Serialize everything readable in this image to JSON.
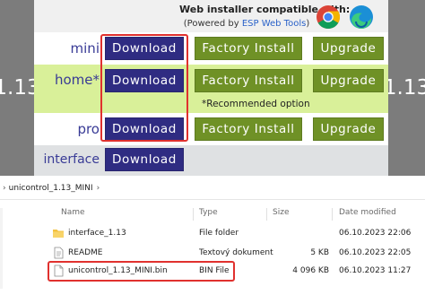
{
  "installer": {
    "version_left": "1.13",
    "version_right": "1.13",
    "header_title": "Web installer compatible with:",
    "header_sub_prefix": "(Powered by ",
    "header_sub_link": "ESP Web Tools",
    "header_sub_suffix": ")",
    "browsers": [
      "chrome-icon",
      "edge-icon"
    ],
    "rows": [
      {
        "label": "mini",
        "download": "Download",
        "factory": "Factory Install",
        "upgrade": "Upgrade"
      },
      {
        "label": "home*",
        "download": "Download",
        "factory": "Factory Install",
        "upgrade": "Upgrade",
        "note": "*Recommended option"
      },
      {
        "label": "pro",
        "download": "Download",
        "factory": "Factory Install",
        "upgrade": "Upgrade"
      },
      {
        "label": "interface",
        "download": "Download"
      }
    ],
    "colors": {
      "download": "#2f2c82",
      "install": "#6f9126",
      "label": "#393b96",
      "highlight": "#e0312e"
    }
  },
  "explorer": {
    "breadcrumb": {
      "folder": "unicontrol_1.13_MINI"
    },
    "columns": {
      "name": "Name",
      "type": "Type",
      "size": "Size",
      "date": "Date modified"
    },
    "files": [
      {
        "icon": "folder-icon",
        "name": "interface_1.13",
        "type": "File folder",
        "size": "",
        "date": "06.10.2023 22:06"
      },
      {
        "icon": "text-file-icon",
        "name": "README",
        "type": "Textový dokument",
        "size": "5 KB",
        "date": "06.10.2023 22:05"
      },
      {
        "icon": "bin-file-icon",
        "name": "unicontrol_1.13_MINI.bin",
        "type": "BIN File",
        "size": "4 096 KB",
        "date": "06.10.2023 11:27"
      }
    ]
  }
}
